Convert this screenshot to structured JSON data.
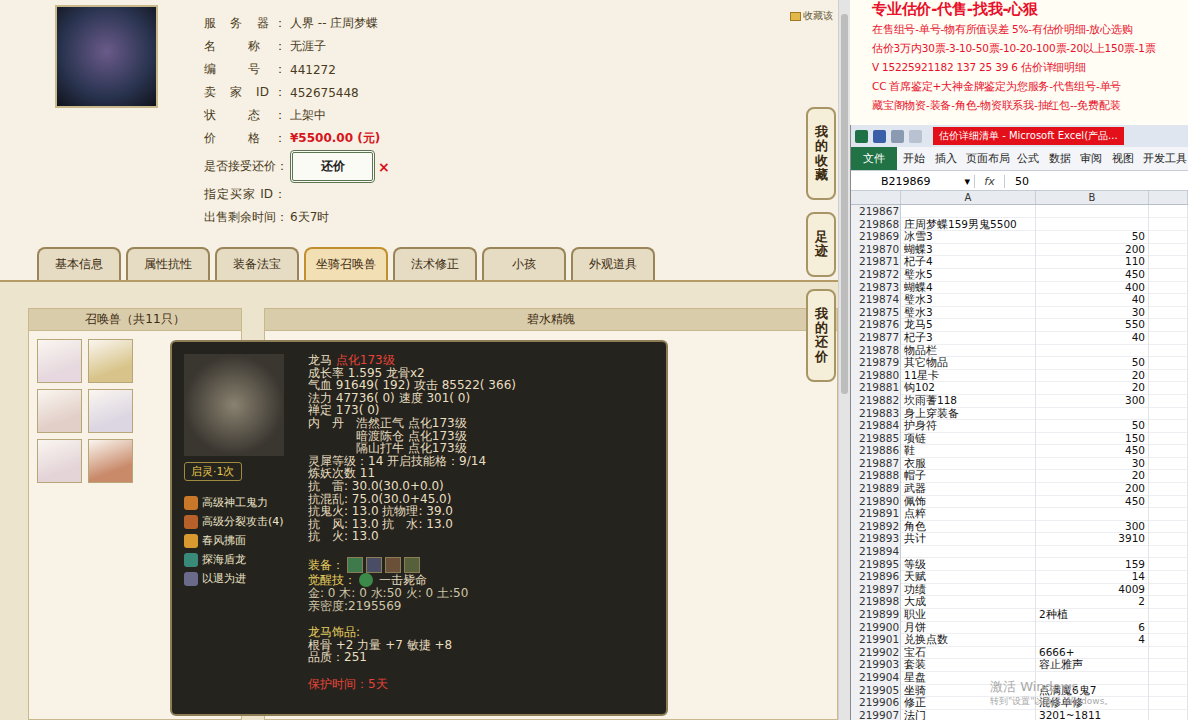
{
  "listing": {
    "portrait": {
      "color": "#2a3450"
    },
    "favorite": "收藏该",
    "fields": [
      {
        "label": "服 务 器：",
        "value": "人界 -- 庄周梦蝶",
        "kind": "text"
      },
      {
        "label": "名 称：",
        "value": "无涯子",
        "kind": "text"
      },
      {
        "label": "编 号：",
        "value": "441272",
        "kind": "text"
      },
      {
        "label": "卖 家 ID：",
        "value": "452675448",
        "kind": "text"
      },
      {
        "label": "状 态：",
        "value": "上架中",
        "kind": "text"
      },
      {
        "label": "价 格：",
        "value": "¥5500.00 (元)",
        "kind": "price"
      },
      {
        "label": "是否接受还价：",
        "value": "还价",
        "kind": "button",
        "dismiss": "×"
      },
      {
        "label": "指定买家 ID：",
        "value": "",
        "kind": "text"
      },
      {
        "label": "出售剩余时间：",
        "value": "6天7时",
        "kind": "text"
      }
    ]
  },
  "side_buttons": [
    "我的收藏",
    "足迹",
    "我的还价"
  ],
  "tabs": [
    {
      "label": "基本信息",
      "selected": false
    },
    {
      "label": "属性抗性",
      "selected": false
    },
    {
      "label": "装备法宝",
      "selected": false
    },
    {
      "label": "坐骑召唤兽",
      "selected": true
    },
    {
      "label": "法术修正",
      "selected": false
    },
    {
      "label": "小孩",
      "selected": false
    },
    {
      "label": "外观道具",
      "selected": false
    }
  ],
  "pet_panel": {
    "title": "召唤兽（共11只）",
    "detail_title": "碧水精魄",
    "thumbnails": [
      {
        "color": "#e6d8de"
      },
      {
        "color": "#d8c48a"
      },
      {
        "color": "#e2cfc8"
      },
      {
        "color": "#dcd6e2"
      },
      {
        "color": "#e4d4d8"
      },
      {
        "color": "#c98a6a"
      }
    ]
  },
  "tooltip": {
    "name": "龙马",
    "name_note": "点化173级",
    "badge": "启灵·1次",
    "skills": [
      {
        "name": "高级神工鬼力",
        "color": "#c9782a"
      },
      {
        "name": "高级分裂攻击(4)",
        "color": "#b8602a"
      },
      {
        "name": "春风拂面",
        "color": "#d89a30"
      },
      {
        "name": "探海盾龙",
        "color": "#3a8a7a"
      },
      {
        "name": "以退为进",
        "color": "#6a6a8a"
      }
    ],
    "stats": [
      "成长率 1.595 龙骨x2",
      "气血 91649( 192) 攻击 85522( 366)",
      "法力 47736( 0) 速度 301( 0)",
      "禅定 173( 0)"
    ],
    "neidan_label": "内　丹",
    "neidan": [
      "浩然正气 点化173级",
      "暗渡陈仓 点化173级",
      "隔山打牛 点化173级"
    ],
    "more_stats": [
      "灵犀等级：14 开启技能格：9/14",
      "炼妖次数 11",
      "抗　雷: 30.0(30.0+0.0)",
      "抗混乱: 75.0(30.0+45.0)",
      "抗鬼火: 13.0 抗物理: 39.0",
      "抗　风: 13.0 抗　水: 13.0",
      "抗　火: 13.0"
    ],
    "equipment_label": "装备：",
    "equipment": [
      {
        "color": "#3f7a4c"
      },
      {
        "color": "#4a4d66"
      },
      {
        "color": "#6a5038"
      },
      {
        "color": "#56603a"
      }
    ],
    "awaken_label": "觉醒技：",
    "awaken_skill": "一击毙命",
    "elements": "金: 0 木: 0 水:50 火: 0 土:50",
    "intimacy": "亲密度:2195569",
    "ornament_title": "龙马饰品:",
    "ornament": "根骨 +2 力量 +7 敏捷 +8",
    "quality": "品质：251",
    "protection": "保护时间：5天"
  },
  "notice": {
    "lines": [
      "专业估价-代售-找我-心狠",
      "在售组号-单号-物有所值误差 5%-有估价明细-放心选购",
      "估价3万内30票-3-10-50票-10-20-100票-20以上150票-1票",
      "V 15225921182  137 25 39 6  估价详细明细",
      "CC 首席鉴定+大神金牌鉴定为您服务-代售组号-单号",
      "藏宝阁物资-装备-角色-物资联系我-抽红包--免费配装"
    ]
  },
  "excel": {
    "title": "估价详细清单 - Microsoft Excel(产品...",
    "ribbon_tabs": [
      {
        "label": "文件",
        "selected": true
      },
      {
        "label": "开始",
        "selected": false
      },
      {
        "label": "插入",
        "selected": false
      },
      {
        "label": "页面布局",
        "selected": false
      },
      {
        "label": "公式",
        "selected": false
      },
      {
        "label": "数据",
        "selected": false
      },
      {
        "label": "审阅",
        "selected": false
      },
      {
        "label": "视图",
        "selected": false
      },
      {
        "label": "开发工具",
        "selected": false
      }
    ],
    "name_box": "B219869",
    "dropdown": "▾",
    "fx": "fx",
    "formula": "50",
    "columns": [
      "A",
      "B"
    ],
    "rows": [
      {
        "n": "219867",
        "a": "",
        "b": "",
        "kind": "number"
      },
      {
        "n": "219868",
        "a": "庄周梦蝶159男鬼5500",
        "b": "",
        "kind": "number"
      },
      {
        "n": "219869",
        "a": "冰雪3",
        "b": "50",
        "kind": "number"
      },
      {
        "n": "219870",
        "a": "蝴蝶3",
        "b": "200",
        "kind": "number"
      },
      {
        "n": "219871",
        "a": "杞子4",
        "b": "110",
        "kind": "number"
      },
      {
        "n": "219872",
        "a": "璧水5",
        "b": "450",
        "kind": "number"
      },
      {
        "n": "219873",
        "a": "蝴蝶4",
        "b": "400",
        "kind": "number"
      },
      {
        "n": "219874",
        "a": "璧水3",
        "b": "40",
        "kind": "number"
      },
      {
        "n": "219875",
        "a": "璧水3",
        "b": "30",
        "kind": "number"
      },
      {
        "n": "219876",
        "a": "龙马5",
        "b": "550",
        "kind": "number"
      },
      {
        "n": "219877",
        "a": "杞子3",
        "b": "40",
        "kind": "number"
      },
      {
        "n": "219878",
        "a": "物品栏",
        "b": "",
        "kind": "number"
      },
      {
        "n": "219879",
        "a": "其它物品",
        "b": "50",
        "kind": "number"
      },
      {
        "n": "219880",
        "a": "11星卡",
        "b": "20",
        "kind": "number"
      },
      {
        "n": "219881",
        "a": "钩102",
        "b": "20",
        "kind": "number"
      },
      {
        "n": "219882",
        "a": "坎雨蓍118",
        "b": "300",
        "kind": "number"
      },
      {
        "n": "219883",
        "a": "身上穿装备",
        "b": "",
        "kind": "number"
      },
      {
        "n": "219884",
        "a": "护身符",
        "b": "50",
        "kind": "number"
      },
      {
        "n": "219885",
        "a": "项链",
        "b": "150",
        "kind": "number"
      },
      {
        "n": "219886",
        "a": "鞋",
        "b": "450",
        "kind": "number"
      },
      {
        "n": "219887",
        "a": "衣服",
        "b": "30",
        "kind": "number"
      },
      {
        "n": "219888",
        "a": "帽子",
        "b": "20",
        "kind": "number"
      },
      {
        "n": "219889",
        "a": "武器",
        "b": "200",
        "kind": "number"
      },
      {
        "n": "219890",
        "a": "佩饰",
        "b": "450",
        "kind": "number"
      },
      {
        "n": "219891",
        "a": "点粹",
        "b": "",
        "kind": "number"
      },
      {
        "n": "219892",
        "a": "角色",
        "b": "300",
        "kind": "number"
      },
      {
        "n": "219893",
        "a": "共计",
        "b": "3910",
        "kind": "number"
      },
      {
        "n": "219894",
        "a": "",
        "b": "",
        "kind": "number"
      },
      {
        "n": "219895",
        "a": "等级",
        "b": "159",
        "kind": "number"
      },
      {
        "n": "219896",
        "a": "天赋",
        "b": "14",
        "kind": "number"
      },
      {
        "n": "219897",
        "a": "功绩",
        "b": "4009",
        "kind": "number"
      },
      {
        "n": "219898",
        "a": "大成",
        "b": "2",
        "kind": "number"
      },
      {
        "n": "219899",
        "a": "职业",
        "b": "2种植",
        "kind": "text"
      },
      {
        "n": "219900",
        "a": "月饼",
        "b": "6",
        "kind": "number"
      },
      {
        "n": "219901",
        "a": "兑换点数",
        "b": "4",
        "kind": "number"
      },
      {
        "n": "219902",
        "a": "宝石",
        "b": "6666+",
        "kind": "text"
      },
      {
        "n": "219903",
        "a": "套装",
        "b": "容止雅声",
        "kind": "text"
      },
      {
        "n": "219904",
        "a": "星盘",
        "b": "",
        "kind": "number"
      },
      {
        "n": "219905",
        "a": "坐骑",
        "b": "点满魔6鬼7",
        "kind": "text"
      },
      {
        "n": "219906",
        "a": "修正",
        "b": "混修单修",
        "kind": "text"
      },
      {
        "n": "219907",
        "a": "法门",
        "b": "3201~1811",
        "kind": "text"
      }
    ]
  },
  "watermark": {
    "title": "激活 Windows",
    "subtitle": "转到\"设置\"以激活 Windows。"
  }
}
